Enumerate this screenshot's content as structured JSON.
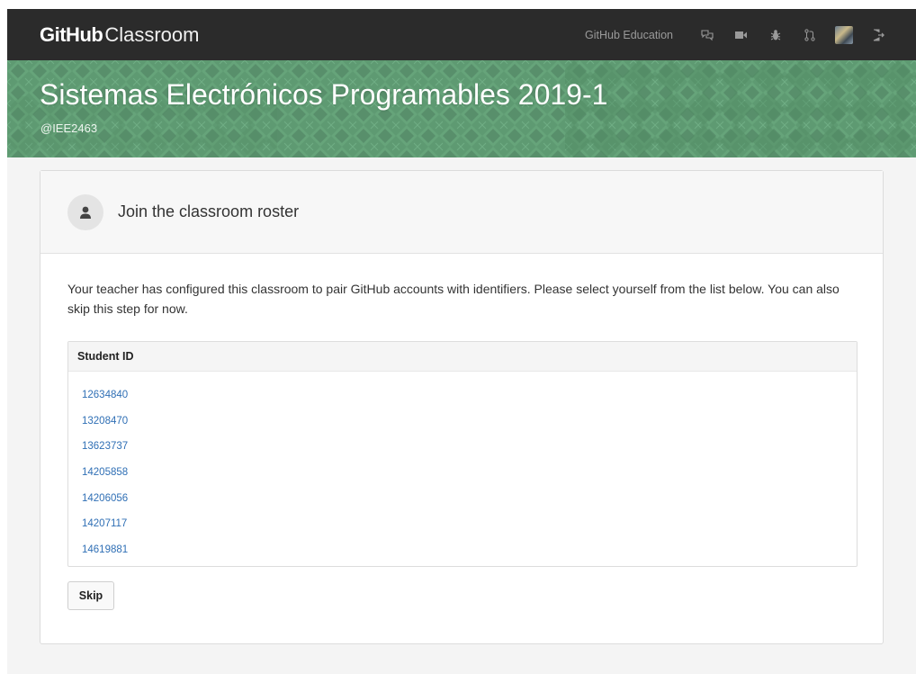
{
  "nav": {
    "brand_bold": "GitHub",
    "brand_light": "Classroom",
    "education_link": "GitHub Education",
    "icons": [
      "chat-icon",
      "video-icon",
      "bug-icon",
      "pull-request-icon",
      "avatar",
      "sign-out-icon"
    ]
  },
  "banner": {
    "title": "Sistemas Electrónicos Programables 2019-1",
    "handle": "@IEE2463",
    "color": "#5e9a72"
  },
  "panel": {
    "title": "Join the classroom roster",
    "description": "Your teacher has configured this classroom to pair GitHub accounts with identifiers. Please select yourself from the list below. You can also skip this step for now.",
    "roster_header": "Student ID",
    "students": [
      "12634840",
      "13208470",
      "13623737",
      "14205858",
      "14206056",
      "14207117",
      "14619881"
    ],
    "skip_label": "Skip"
  },
  "colors": {
    "nav_bg": "#2b2b2b",
    "link": "#2f6fb5"
  }
}
